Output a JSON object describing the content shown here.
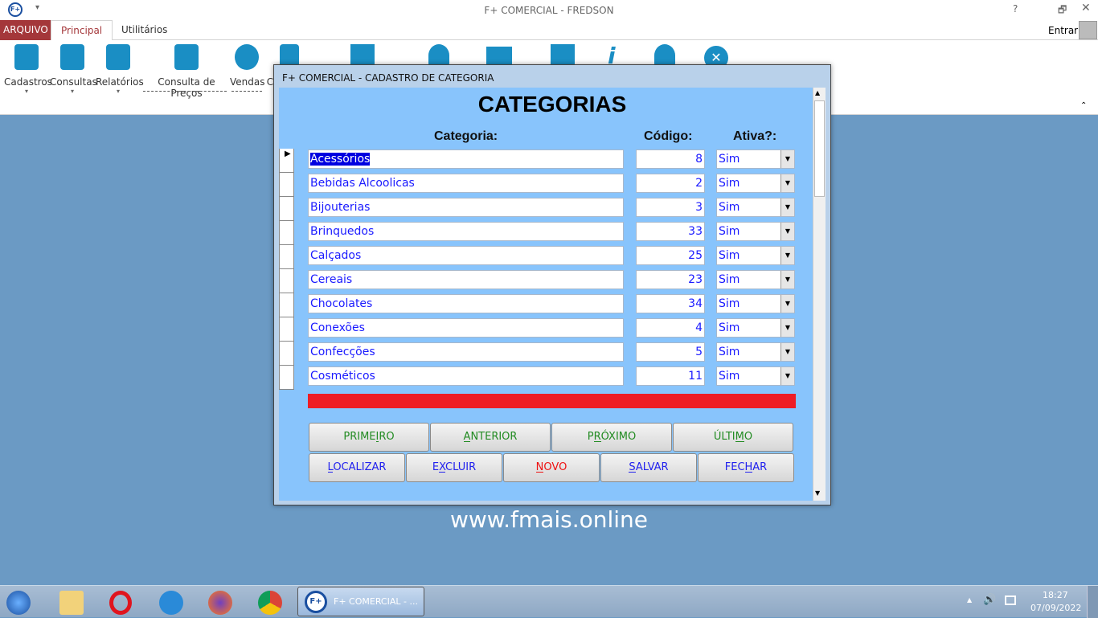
{
  "window": {
    "title": "F+ COMERCIAL - FREDSON",
    "help": "?",
    "signin": "Entrar"
  },
  "tabs": [
    {
      "label": "ARQUIVO"
    },
    {
      "label": "Principal"
    },
    {
      "label": "Utilitários"
    }
  ],
  "ribbon": [
    {
      "label": "Cadastros",
      "icon": "add-document-icon"
    },
    {
      "label": "Consultas",
      "icon": "search-document-icon"
    },
    {
      "label": "Relatórios",
      "icon": "clipboard-chart-icon"
    },
    {
      "label": "Consulta de Preços",
      "icon": "monitor-search-icon"
    },
    {
      "label": "Vendas",
      "icon": "basket-add-icon"
    },
    {
      "label": "C",
      "icon": "invoice-icon"
    }
  ],
  "dialog": {
    "title": "F+ COMERCIAL - CADASTRO DE CATEGORIA",
    "heading": "CATEGORIAS",
    "columns": {
      "categoria": "Categoria:",
      "codigo": "Código:",
      "ativa": "Ativa?:"
    },
    "rows": [
      {
        "categoria": "Acessórios",
        "codigo": "8",
        "ativa": "Sim"
      },
      {
        "categoria": "Bebidas Alcoolicas",
        "codigo": "2",
        "ativa": "Sim"
      },
      {
        "categoria": "Bijouterias",
        "codigo": "3",
        "ativa": "Sim"
      },
      {
        "categoria": "Brinquedos",
        "codigo": "33",
        "ativa": "Sim"
      },
      {
        "categoria": "Calçados",
        "codigo": "25",
        "ativa": "Sim"
      },
      {
        "categoria": "Cereais",
        "codigo": "23",
        "ativa": "Sim"
      },
      {
        "categoria": "Chocolates",
        "codigo": "34",
        "ativa": "Sim"
      },
      {
        "categoria": "Conexões",
        "codigo": "4",
        "ativa": "Sim"
      },
      {
        "categoria": "Confecções",
        "codigo": "5",
        "ativa": "Sim"
      },
      {
        "categoria": "Cosméticos",
        "codigo": "11",
        "ativa": "Sim"
      }
    ],
    "buttons_nav": [
      {
        "label": "PRIMEIRO"
      },
      {
        "label": "ANTERIOR"
      },
      {
        "label": "PRÓXIMO"
      },
      {
        "label": "ÚLTIMO"
      }
    ],
    "buttons_act": [
      {
        "label": "LOCALIZAR"
      },
      {
        "label": "EXCLUIR"
      },
      {
        "label": "NOVO"
      },
      {
        "label": "SALVAR"
      },
      {
        "label": "FECHAR"
      }
    ]
  },
  "desktop": {
    "url": "www.fmais.online"
  },
  "taskbar": {
    "active_window": "F+ COMERCIAL - ...",
    "time": "18:27",
    "date": "07/09/2022"
  },
  "colors": {
    "form_bg": "#88c4fc",
    "accent_red": "#ee1c25",
    "arquivo": "#a4373a",
    "icon_blue": "#1a8ec4"
  }
}
